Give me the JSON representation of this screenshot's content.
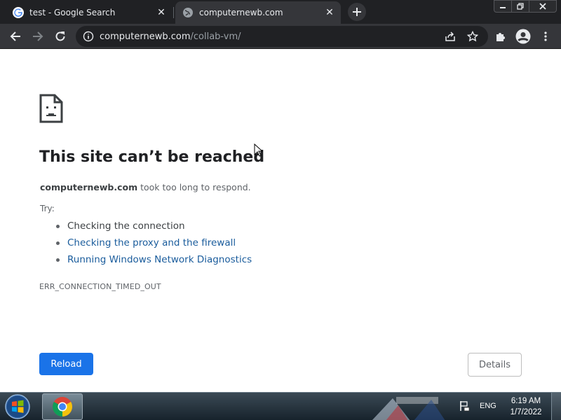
{
  "browser": {
    "tabs": [
      {
        "title": "test - Google Search",
        "favicon": "google-icon",
        "active": false
      },
      {
        "title": "computernewb.com",
        "favicon": "globe-icon",
        "active": true
      }
    ],
    "new_tab_icon": "plus-icon",
    "window_controls": [
      "minimize-icon",
      "restore-icon",
      "close-icon"
    ],
    "toolbar": {
      "back_icon": "back-arrow-icon",
      "forward_icon": "forward-arrow-icon",
      "reload_icon": "reload-icon",
      "url_host": "computernewb.com",
      "url_path": "/collab-vm/",
      "site_info_icon": "info-icon",
      "share_icon": "share-icon",
      "bookmark_icon": "star-icon",
      "extensions_icon": "puzzle-icon",
      "profile_icon": "avatar-icon",
      "menu_icon": "more-vert-icon"
    }
  },
  "error_page": {
    "icon": "sad-document-icon",
    "heading": "This site can’t be reached",
    "host": "computernewb.com",
    "summary_rest": " took too long to respond.",
    "try_label": "Try:",
    "suggestions": [
      "Checking the connection",
      "Checking the proxy and the firewall",
      "Running Windows Network Diagnostics"
    ],
    "error_code": "ERR_CONNECTION_TIMED_OUT",
    "reload_label": "Reload",
    "details_label": "Details"
  },
  "taskbar": {
    "start_icon": "windows-orb-icon",
    "pinned_app_icon": "chrome-icon",
    "tray_icon": "action-center-flag-icon",
    "language": "ENG",
    "time": "6:19 AM",
    "date": "1/7/2022"
  },
  "colors": {
    "link": "#1a5c9c",
    "primary_button": "#1a73e8",
    "chrome_dark": "#202124",
    "chrome_toolbar": "#35363a"
  }
}
